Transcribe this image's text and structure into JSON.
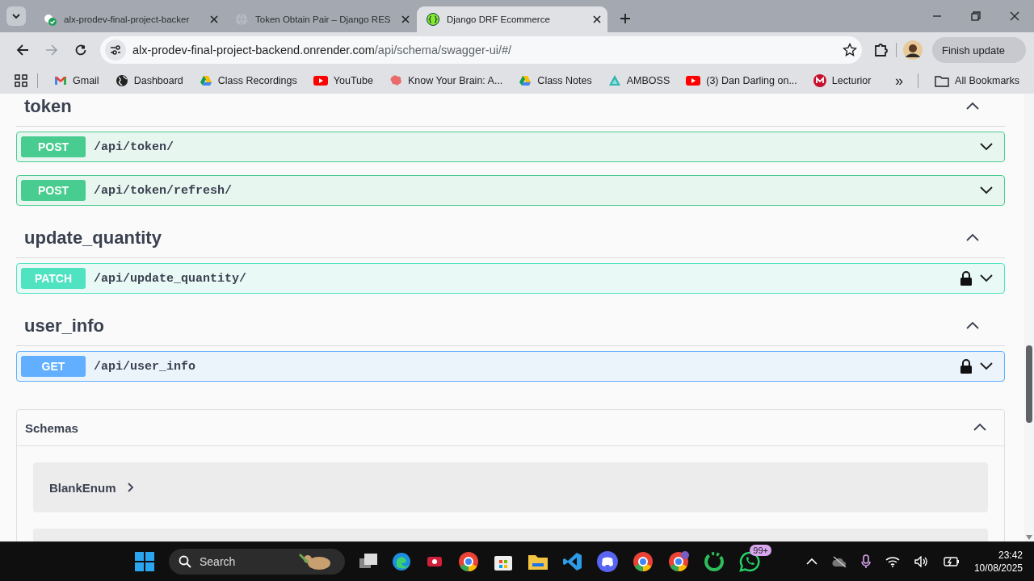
{
  "browser": {
    "tabs": [
      {
        "title": "alx-prodev-final-project-backer",
        "selected": false
      },
      {
        "title": "Token Obtain Pair – Django RES",
        "selected": false
      },
      {
        "title": "Django DRF Ecommerce",
        "selected": true
      }
    ],
    "address": {
      "host": "alx-prodev-final-project-backend.onrender.com",
      "path": "/api/schema/swagger-ui/#/"
    },
    "update_button": "Finish update",
    "bookmarks": [
      {
        "label": "Gmail"
      },
      {
        "label": "Dashboard"
      },
      {
        "label": "Class Recordings"
      },
      {
        "label": "YouTube"
      },
      {
        "label": "Know Your Brain: A..."
      },
      {
        "label": "Class Notes"
      },
      {
        "label": "AMBOSS"
      },
      {
        "label": "(3) Dan Darling on..."
      },
      {
        "label": "Lecturior"
      }
    ],
    "more_bookmarks": "»",
    "all_bookmarks": "All Bookmarks"
  },
  "sections": [
    {
      "name": "token",
      "expanded": true,
      "operations": [
        {
          "method": "POST",
          "kind": "post",
          "path": "/api/token/",
          "locked": false
        },
        {
          "method": "POST",
          "kind": "post",
          "path": "/api/token/refresh/",
          "locked": false
        }
      ]
    },
    {
      "name": "update_quantity",
      "expanded": true,
      "operations": [
        {
          "method": "PATCH",
          "kind": "patch",
          "path": "/api/update_quantity/",
          "locked": true
        }
      ]
    },
    {
      "name": "user_info",
      "expanded": true,
      "operations": [
        {
          "method": "GET",
          "kind": "get",
          "path": "/api/user_info",
          "locked": true
        }
      ]
    }
  ],
  "schemas": {
    "title": "Schemas",
    "expanded": true,
    "items": [
      {
        "name": "BlankEnum"
      }
    ]
  },
  "taskbar": {
    "search": "Search",
    "badge": "99+",
    "time": "23:42",
    "date": "10/08/2025"
  }
}
